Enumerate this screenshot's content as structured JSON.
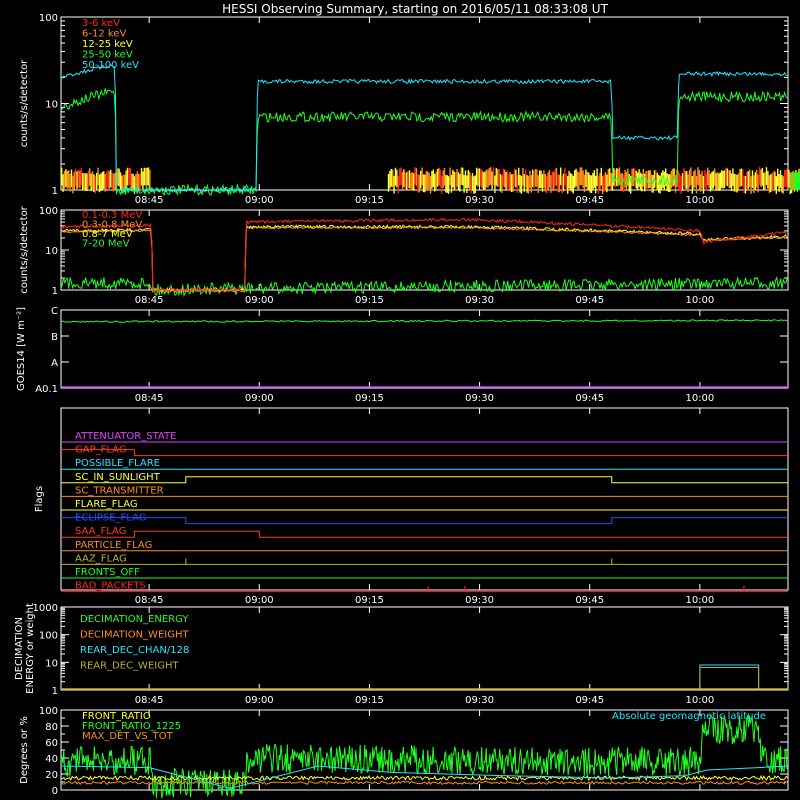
{
  "title": "HESSI Observing Summary, starting on 2016/05/11 08:33:08 UT",
  "time_axis": {
    "start": "08:33:08",
    "end": "10:12:00",
    "tick_labels": [
      "08:45",
      "09:00",
      "09:15",
      "09:30",
      "09:45",
      "10:00"
    ]
  },
  "chart_data": [
    {
      "type": "line",
      "name": "panel-counts-energy",
      "ylabel": "counts/s/detector",
      "yscale": "log",
      "ylim": [
        1,
        100
      ],
      "ytick_labels": [
        "1",
        "10",
        "100"
      ],
      "series": [
        {
          "name": "3-6 keV",
          "color": "#ff2020"
        },
        {
          "name": "6-12 keV",
          "color": "#ff8c1a"
        },
        {
          "name": "12-25 keV",
          "color": "#ffff33"
        },
        {
          "name": "25-50 keV",
          "color": "#22ff22"
        },
        {
          "name": "50-100 keV",
          "color": "#22e5ff"
        }
      ],
      "levels": {
        "50-100 keV": [
          [
            0,
            20
          ],
          [
            12,
            28
          ],
          [
            12.5,
            1
          ],
          [
            44,
            1
          ],
          [
            44.5,
            18
          ],
          [
            124,
            18
          ],
          [
            124.5,
            4
          ],
          [
            139,
            4
          ],
          [
            139.5,
            22
          ],
          [
            164,
            22
          ]
        ],
        "25-50 keV": [
          [
            0,
            9
          ],
          [
            12,
            14
          ],
          [
            12.5,
            1
          ],
          [
            44,
            1
          ],
          [
            44.5,
            7
          ],
          [
            124,
            7
          ],
          [
            124.5,
            1.3
          ],
          [
            139,
            1.3
          ],
          [
            139.5,
            12
          ],
          [
            164,
            12
          ]
        ],
        "12-25 keV": [
          [
            0,
            1.5
          ],
          [
            12,
            1.5
          ],
          [
            12.5,
            1
          ],
          [
            44,
            1
          ],
          [
            44.5,
            1.5
          ],
          [
            164,
            1.5
          ]
        ]
      }
    },
    {
      "type": "line",
      "name": "panel-counts-mev",
      "ylabel": "counts/s/detector",
      "yscale": "log",
      "ylim": [
        1,
        100
      ],
      "ytick_labels": [
        "1",
        "10",
        "100"
      ],
      "series": [
        {
          "name": "0.1-0.3 MeV",
          "color": "#ff2020"
        },
        {
          "name": "0.3-0.8 MeV",
          "color": "#ff8c1a"
        },
        {
          "name": "0.8-7 MeV",
          "color": "#ffff33"
        },
        {
          "name": "7-20 MeV",
          "color": "#22ff22"
        }
      ]
    },
    {
      "type": "line",
      "name": "panel-goes",
      "ylabel": "GOES14 [W m⁻²]",
      "ytick_labels": [
        "A0.1",
        "A",
        "B",
        "C"
      ],
      "series": [
        {
          "name": "GOES long",
          "color": "#22ff22"
        },
        {
          "name": "GOES short",
          "color": "#c040ff"
        }
      ]
    },
    {
      "type": "line",
      "name": "panel-flags",
      "ylabel": "Flags",
      "flags": [
        {
          "name": "ATTENUATOR_STATE",
          "color": "#e040ff"
        },
        {
          "name": "GAP_FLAG",
          "color": "#ff3a1a"
        },
        {
          "name": "POSSIBLE_FLARE",
          "color": "#22e5ff"
        },
        {
          "name": "SC_IN_SUNLIGHT",
          "color": "#ffff33"
        },
        {
          "name": "SC_TRANSMITTER",
          "color": "#ff8c1a"
        },
        {
          "name": "FLARE_FLAG",
          "color": "#ffff33"
        },
        {
          "name": "ECLIPSE_FLAG",
          "color": "#2050ff"
        },
        {
          "name": "SAA_FLAG",
          "color": "#ff3a1a"
        },
        {
          "name": "PARTICLE_FLAG",
          "color": "#ff8c1a"
        },
        {
          "name": "AAZ_FLAG",
          "color": "#b8b020"
        },
        {
          "name": "FRONTS_OFF",
          "color": "#22ff22"
        },
        {
          "name": "BAD_PACKETS",
          "color": "#ff2020"
        }
      ]
    },
    {
      "type": "line",
      "name": "panel-decimation",
      "ylabel": "DECIMATION ENERGY or weight",
      "yscale": "log",
      "ylim": [
        1,
        1000
      ],
      "ytick_labels": [
        "1",
        "10",
        "100",
        "1000"
      ],
      "series": [
        {
          "name": "DECIMATION_ENERGY",
          "color": "#22ff22"
        },
        {
          "name": "DECIMATION_WEIGHT",
          "color": "#ff8c1a"
        },
        {
          "name": "REAR_DEC_CHAN/128",
          "color": "#22e5ff"
        },
        {
          "name": "REAR_DEC_WEIGHT",
          "color": "#b8b020"
        }
      ]
    },
    {
      "type": "line",
      "name": "panel-ratio",
      "ylabel": "Degrees or %",
      "ylim": [
        0,
        100
      ],
      "ytick_labels": [
        "0",
        "20",
        "40",
        "60",
        "80",
        "100"
      ],
      "annotation": "Absolute geomagnetic latitude",
      "series": [
        {
          "name": "FRONT_RATIO",
          "color": "#ffff33"
        },
        {
          "name": "FRONT_RATIO_1225",
          "color": "#22ff22"
        },
        {
          "name": "MAX_DET_VS_TOT",
          "color": "#ff8c1a"
        }
      ]
    }
  ]
}
